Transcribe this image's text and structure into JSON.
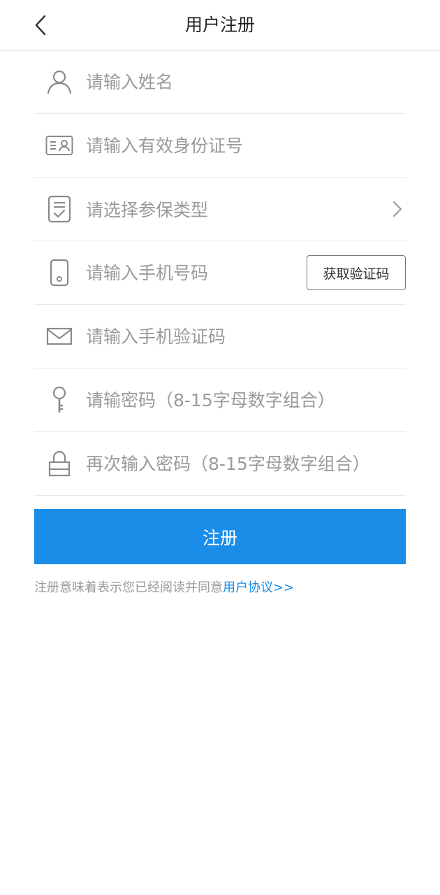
{
  "header": {
    "title": "用户注册"
  },
  "form": {
    "name_placeholder": "请输入姓名",
    "id_placeholder": "请输入有效身份证号",
    "insurance_type_placeholder": "请选择参保类型",
    "phone_placeholder": "请输入手机号码",
    "get_code_label": "获取验证码",
    "code_placeholder": "请输入手机验证码",
    "password_placeholder": "请输密码（8-15字母数字组合）",
    "confirm_password_placeholder": "再次输入密码（8-15字母数字组合）"
  },
  "submit_label": "注册",
  "agreement": {
    "text": "注册意味着表示您已经阅读并同意",
    "link": "用户协议>>"
  },
  "colors": {
    "accent": "#1a8de8",
    "placeholder": "#9a9a9a",
    "icon": "#8a8a8a"
  }
}
